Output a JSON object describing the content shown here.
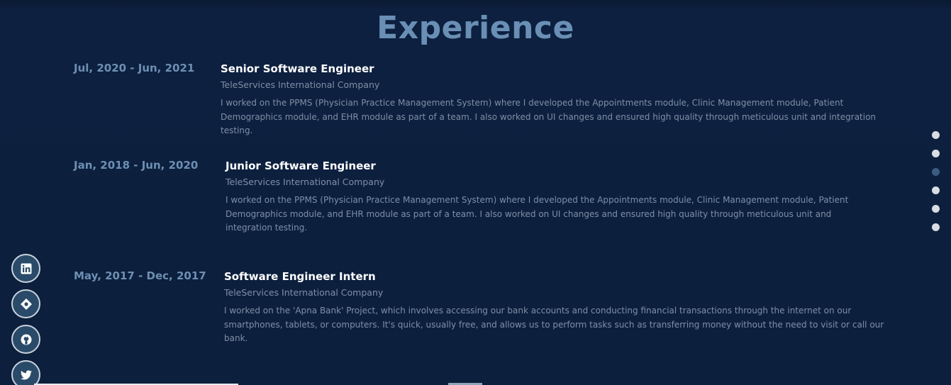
{
  "section": {
    "title": "Experience"
  },
  "experience": [
    {
      "date": "Jul, 2020 - Jun, 2021",
      "role": "Senior Software Engineer",
      "company": "TeleServices International Company",
      "description": "I worked on the PPMS (Physician Practice Management System) where I developed the Appointments module, Clinic Management module, Patient Demographics module, and EHR module as part of a team. I also worked on UI changes and ensured high quality through meticulous unit and integration testing."
    },
    {
      "date": "Jan, 2018 - Jun, 2020",
      "role": "Junior Software Engineer",
      "company": "TeleServices International Company",
      "description": "I worked on the PPMS (Physician Practice Management System) where I developed the Appointments module, Clinic Management module, Patient Demographics module, and EHR module as part of a team. I also worked on UI changes and ensured high quality through meticulous unit and integration testing."
    },
    {
      "date": "May, 2017 - Dec, 2017",
      "role": "Software Engineer Intern",
      "company": "TeleServices International Company",
      "description": "I worked on the 'Apna Bank' Project, which involves accessing our bank accounts and conducting financial transactions through the internet on our smartphones, tablets, or computers. It's quick, usually free, and allows us to perform tasks such as transferring money without the need to visit or call our bank."
    }
  ],
  "section_nav": {
    "count": 6,
    "active_index": 2
  },
  "social": [
    {
      "icon": "linkedin-icon"
    },
    {
      "icon": "portfolio-icon"
    },
    {
      "icon": "github-icon"
    },
    {
      "icon": "twitter-icon"
    }
  ],
  "colors": {
    "background": "#0c1f3c",
    "title": "#6a8fb5",
    "date": "#6d8fb3",
    "role": "#ffffff",
    "muted_text": "#7e8fa6",
    "dot": "#d8dde3",
    "dot_active": "#3b5d80"
  }
}
